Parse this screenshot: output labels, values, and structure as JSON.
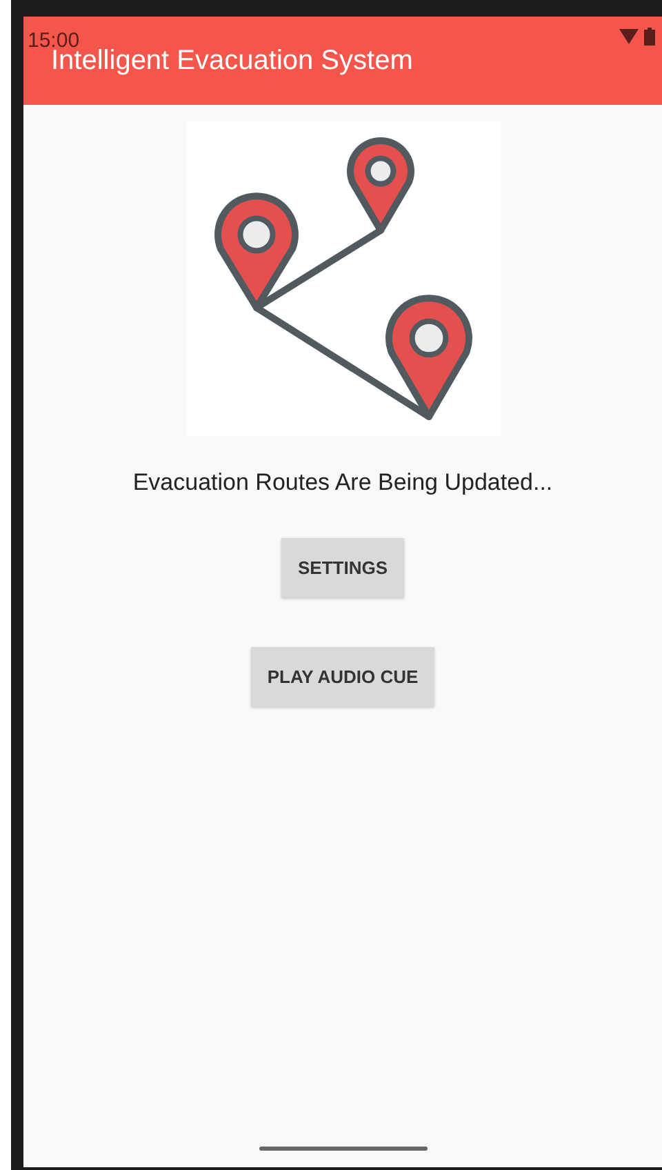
{
  "status_bar": {
    "time": "15:00"
  },
  "app_bar": {
    "title": "Intelligent Evacuation System"
  },
  "status_text": "Evacuation Routes Are Being Updated...",
  "buttons": [
    {
      "label": "SETTINGS"
    },
    {
      "label": "PLAY AUDIO CUE"
    }
  ]
}
